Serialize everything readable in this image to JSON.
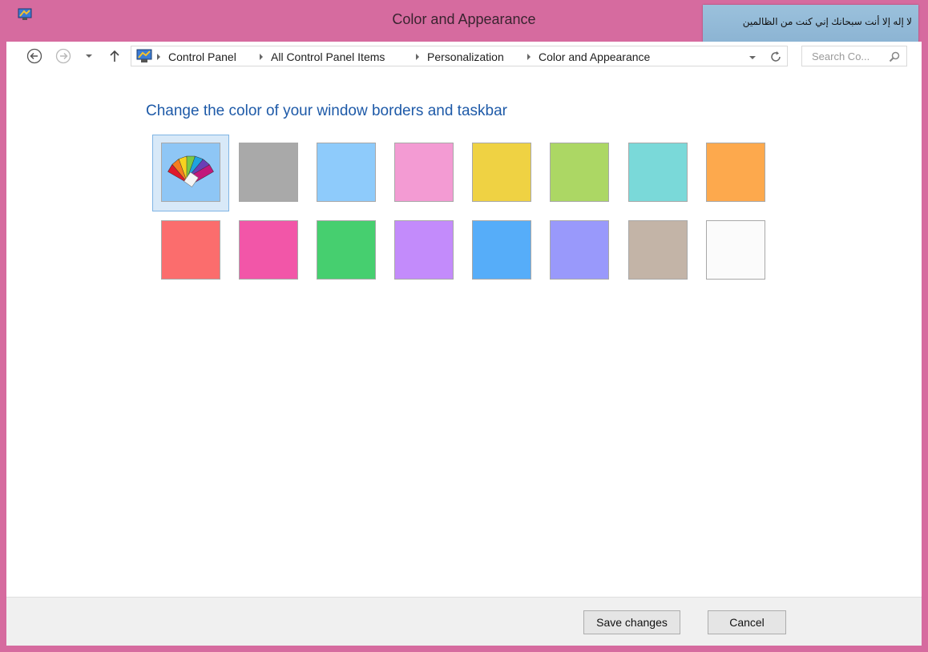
{
  "window": {
    "title": "Color and Appearance",
    "overlay_text": "لا إله إلا أنت سبحانك إني كنت من الظالمين"
  },
  "address": {
    "breadcrumbs": [
      "Control Panel",
      "All Control Panel Items",
      "Personalization",
      "Color and Appearance"
    ],
    "search_placeholder": "Search Co..."
  },
  "main": {
    "heading": "Change the color of your window borders and taskbar",
    "swatches": [
      {
        "name": "automatic",
        "color": "#8ec6f5",
        "selected": true
      },
      {
        "name": "gray",
        "color": "#a9a9a9"
      },
      {
        "name": "light-blue",
        "color": "#8ecbfb"
      },
      {
        "name": "pink",
        "color": "#f39bd3"
      },
      {
        "name": "yellow",
        "color": "#efd243"
      },
      {
        "name": "lime-green",
        "color": "#acd764"
      },
      {
        "name": "teal",
        "color": "#7ad9d9"
      },
      {
        "name": "orange",
        "color": "#fda94d"
      },
      {
        "name": "red",
        "color": "#fb6d6d"
      },
      {
        "name": "magenta",
        "color": "#f256a8"
      },
      {
        "name": "green",
        "color": "#46cf6f"
      },
      {
        "name": "violet",
        "color": "#c38bfb"
      },
      {
        "name": "blue",
        "color": "#56adf9"
      },
      {
        "name": "periwinkle",
        "color": "#9999fb"
      },
      {
        "name": "taupe",
        "color": "#c3b4a7"
      },
      {
        "name": "white",
        "color": "#fbfbfb"
      }
    ]
  },
  "footer": {
    "save_label": "Save changes",
    "cancel_label": "Cancel"
  }
}
